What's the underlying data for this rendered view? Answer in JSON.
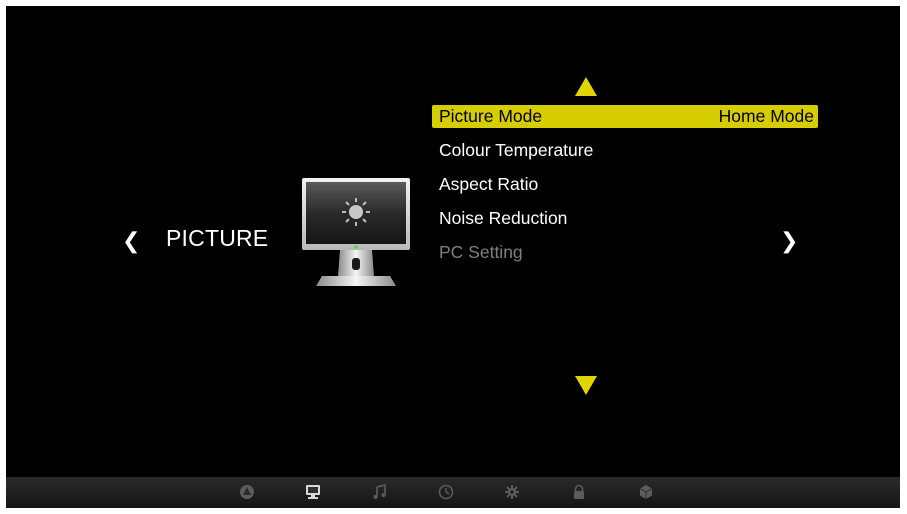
{
  "section": {
    "title": "PICTURE",
    "prev_arrow": "❮",
    "next_arrow": "❯"
  },
  "menu": {
    "items": [
      {
        "label": "Picture Mode",
        "value": "Home Mode",
        "state": "selected"
      },
      {
        "label": "Colour Temperature",
        "value": "",
        "state": "normal"
      },
      {
        "label": "Aspect Ratio",
        "value": "",
        "state": "normal"
      },
      {
        "label": "Noise Reduction",
        "value": "",
        "state": "normal"
      },
      {
        "label": "PC Setting",
        "value": "",
        "state": "disabled"
      }
    ]
  },
  "bottom_bar": {
    "icons": [
      "channel-icon",
      "picture-icon",
      "sound-icon",
      "time-icon",
      "setup-icon",
      "lock-icon",
      "app-icon"
    ],
    "active": "picture-icon"
  },
  "colors": {
    "highlight": "#d6cd00",
    "arrow": "#e2d400",
    "background": "#000000"
  }
}
